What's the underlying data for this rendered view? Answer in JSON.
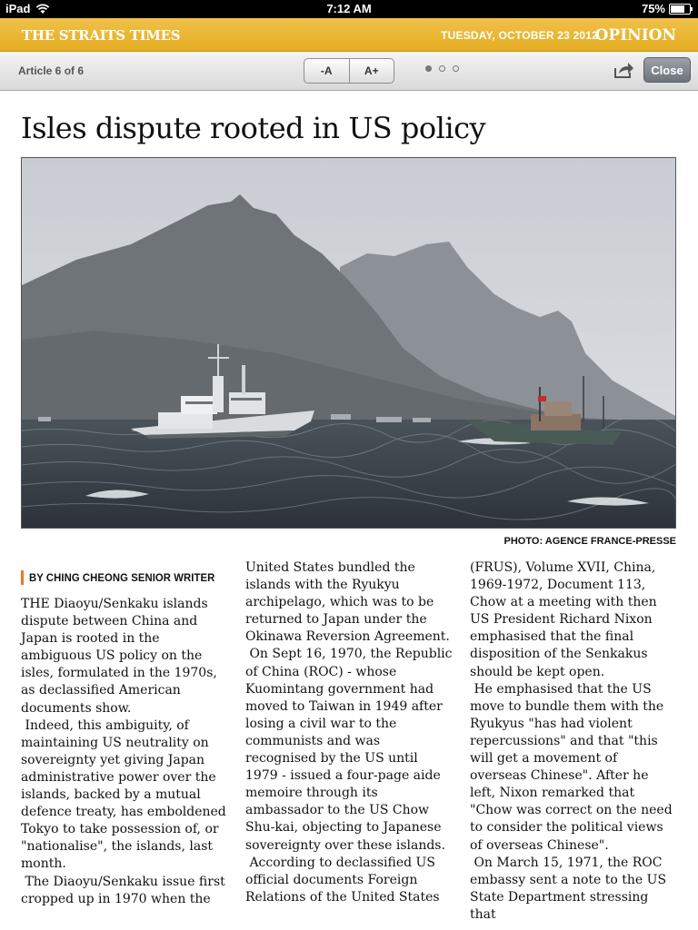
{
  "status_bar": {
    "device": "iPad",
    "time": "7:12 AM",
    "battery": "75%",
    "battery_level": 0.75
  },
  "masthead": {
    "brand": "THE STRAITS TIMES",
    "date": "TUESDAY, OCTOBER 23 2012",
    "section": "OPINION"
  },
  "toolbar": {
    "article_count": "Article 6 of 6",
    "decrease_font": "-A",
    "increase_font": "A+",
    "page_dots": 3,
    "active_dot": 0,
    "close_label": "Close"
  },
  "article": {
    "headline": "Isles dispute rooted in US policy",
    "photo_credit": "PHOTO: AGENCE FRANCE-PRESSE",
    "byline": "BY CHING CHEONG SENIOR WRITER",
    "columns": [
      [
        "THE Diaoyu/Senkaku islands dispute between China and Japan is rooted in the ambiguous US policy on the isles, formulated in the 1970s, as declassified American documents show.",
        " Indeed, this ambiguity, of maintaining US neutrality on sovereignty yet giving Japan administrative power over the islands, backed by a mutual defence treaty, has emboldened Tokyo to take possession of, or \"nationalise\", the islands, last month.",
        " The Diaoyu/Senkaku issue first cropped up in 1970 when the"
      ],
      [
        "United States bundled the islands with the Ryukyu archipelago, which was to be returned to Japan under the Okinawa Reversion Agreement.",
        " On Sept 16, 1970, the Republic of China (ROC) - whose Kuomintang government had moved to Taiwan in 1949 after losing a civil war to the communists and was recognised by the US until 1979 - issued a four-page aide memoire through its ambassador to the US Chow Shu-kai, objecting to Japanese sovereignty over these islands.",
        " According to declassified US official documents Foreign Relations of the United States"
      ],
      [
        "(FRUS), Volume XVII, China, 1969-1972, Document 113, Chow at a meeting with then US President Richard Nixon emphasised that the final disposition of the Senkakus should be kept open.",
        " He emphasised that the US move to bundle them with the Ryukyus \"has had violent repercussions\" and that \"this will get a movement of overseas Chinese\". After he left, Nixon remarked that \"Chow was correct on the need to consider the political views of overseas Chinese\".",
        " On March 15, 1971, the ROC embassy sent a note to the US State Department stressing that"
      ]
    ]
  },
  "colors": {
    "masthead": "#e8b22a",
    "byline_accent": "#e8762c"
  },
  "icons": [
    "wifi-icon",
    "battery-icon",
    "share-icon"
  ]
}
